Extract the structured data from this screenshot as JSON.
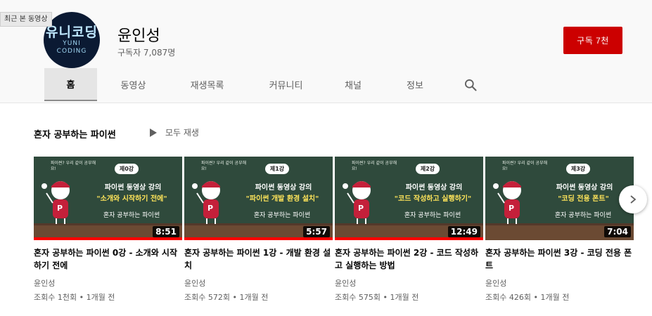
{
  "recent_tag": "최근 본 동영상",
  "channel": {
    "name": "윤인성",
    "subscribers": "구독자 7,087명",
    "avatar_text": "유니코딩",
    "avatar_sub": "YUNI",
    "avatar_sub2": "CODING",
    "subscribe_label": "구독  7천"
  },
  "tabs": [
    {
      "label": "홈",
      "active": true
    },
    {
      "label": "동영상",
      "active": false
    },
    {
      "label": "재생목록",
      "active": false
    },
    {
      "label": "커뮤니티",
      "active": false
    },
    {
      "label": "채널",
      "active": false
    },
    {
      "label": "정보",
      "active": false
    }
  ],
  "shelf": {
    "title": "혼자 공부하는 파이썬",
    "play_all": "모두 재생"
  },
  "videos": [
    {
      "thumb_badge": "제0강",
      "thumb_line1": "파이썬 동영상 강의",
      "thumb_line2": "\"소개와 시작하기 전에\"",
      "thumb_book": "혼자 공부하는 파이썬",
      "thumb_note": "파이썬? 우리 같이 공부해요!",
      "duration": "8:51",
      "progress": 1.0,
      "title": "혼자 공부하는 파이썬 0강 - 소개와 시작하기 전에",
      "channel": "윤인성",
      "meta": "조회수 1천회 • 1개월 전"
    },
    {
      "thumb_badge": "제1강",
      "thumb_line1": "파이썬 동영상 강의",
      "thumb_line2": "\"파이썬 개발 환경 설치\"",
      "thumb_book": "혼자 공부하는 파이썬",
      "thumb_note": "파이썬? 우리 같이 공부해요!",
      "duration": "5:57",
      "progress": 1.0,
      "title": "혼자 공부하는 파이썬 1강 - 개발 환경 설치",
      "channel": "윤인성",
      "meta": "조회수 572회 • 1개월 전"
    },
    {
      "thumb_badge": "제2강",
      "thumb_line1": "파이썬 동영상 강의",
      "thumb_line2": "\"코드 작성하고 실행하기\"",
      "thumb_book": "혼자 공부하는 파이썬",
      "thumb_note": "파이썬? 우리 같이 공부해요!",
      "duration": "12:49",
      "progress": 1.0,
      "title": "혼자 공부하는 파이썬 2강 - 코드 작성하고 실행하는 방법",
      "channel": "윤인성",
      "meta": "조회수 575회 • 1개월 전"
    },
    {
      "thumb_badge": "제3강",
      "thumb_line1": "파이썬 동영상 강의",
      "thumb_line2": "\"코딩 전용 폰트\"",
      "thumb_book": "혼자 공부하는 파이썬",
      "thumb_note": "파이썬? 우리 같이 공부해요!",
      "duration": "7:04",
      "progress": 0.0,
      "title": "혼자 공부하는 파이썬 3강 - 코딩 전용 폰트",
      "channel": "윤인성",
      "meta": "조회수 426회 • 1개월 전"
    }
  ],
  "icons": {
    "search": "search-icon",
    "play": "play-icon",
    "next": "chevron-right-icon"
  },
  "colors": {
    "subscribe": "#cc0000",
    "progress": "#ff0000",
    "chalkboard": "#2f4a3c"
  }
}
